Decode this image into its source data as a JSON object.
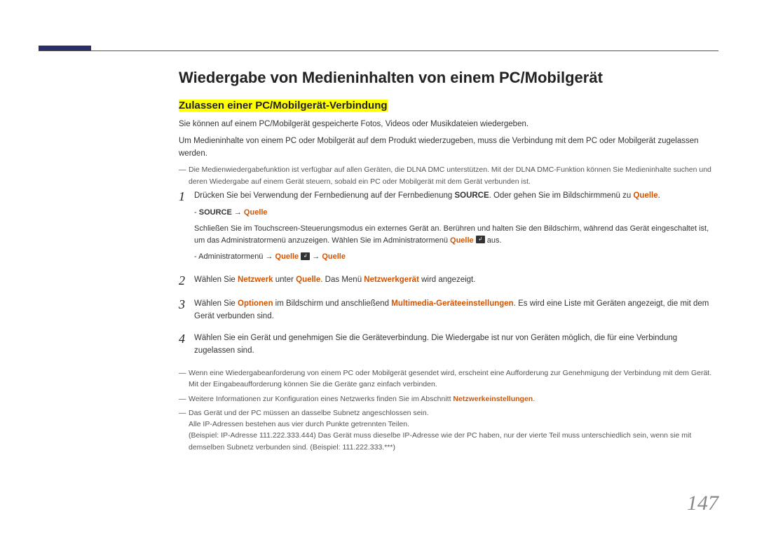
{
  "heading": "Wiedergabe von Medieninhalten von einem PC/Mobilgerät",
  "subheading": "Zulassen einer PC/Mobilgerät-Verbindung",
  "intro1": "Sie können auf einem PC/Mobilgerät gespeicherte Fotos, Videos oder Musikdateien wiedergeben.",
  "intro2": "Um Medieninhalte von einem PC oder Mobilgerät auf dem Produkt wiederzugeben, muss die Verbindung mit dem PC oder Mobilgerät zugelassen werden.",
  "note_top": "Die Medienwiedergabefunktion ist verfügbar auf allen Geräten, die DLNA DMC unterstützen. Mit der DLNA DMC-Funktion können Sie Medieninhalte suchen und deren Wiedergabe auf einem Gerät steuern, sobald ein PC oder Mobilgerät mit dem Gerät verbunden ist.",
  "steps": [
    {
      "num": "1",
      "pre": "Drücken Sie bei Verwendung der Fernbedienung auf der Fernbedienung ",
      "bold1": "SOURCE",
      "mid1": ". Oder gehen Sie im Bildschirmmenü zu ",
      "orange1": "Quelle",
      "post1": ".",
      "sub1_pre": "- ",
      "sub1_b": "SOURCE",
      "sub1_arrow": " → ",
      "sub1_o": "Quelle",
      "line2_pre": "Schließen Sie im Touchscreen-Steuerungsmodus ein externes Gerät an. Berühren und halten Sie den Bildschirm, während das Gerät eingeschaltet ist, um das Administratormenü anzuzeigen. Wählen Sie im Administratormenü ",
      "line2_o": "Quelle",
      "line2_post": " aus.",
      "sub2_pre": "- Administratormenü → ",
      "sub2_o1": "Quelle",
      "sub2_arrow": " → ",
      "sub2_o2": "Quelle"
    },
    {
      "num": "2",
      "pre": "Wählen Sie ",
      "o1": "Netzwerk",
      "mid": " unter ",
      "o2": "Quelle",
      "mid2": ". Das Menü ",
      "o3": "Netzwerkgerät",
      "post": " wird angezeigt."
    },
    {
      "num": "3",
      "pre": "Wählen Sie ",
      "o1": "Optionen",
      "mid": " im Bildschirm und anschließend ",
      "o2": "Multimedia-Geräteeinstellungen",
      "post": ". Es wird eine Liste mit Geräten angezeigt, die mit dem Gerät verbunden sind."
    },
    {
      "num": "4",
      "text": "Wählen Sie ein Gerät und genehmigen Sie die Geräteverbindung. Die Wiedergabe ist nur von Geräten möglich, die für eine Verbindung zugelassen sind."
    }
  ],
  "footnotes": {
    "n1a": "Wenn eine Wiedergabeanforderung von einem PC oder Mobilgerät gesendet wird, erscheint eine Aufforderung zur Genehmigung der Verbindung mit dem Gerät.",
    "n1b": "Mit der Eingabeaufforderung können Sie die Geräte ganz einfach verbinden.",
    "n2_pre": "Weitere Informationen zur Konfiguration eines Netzwerks finden Sie im Abschnitt ",
    "n2_o": "Netzwerkeinstellungen",
    "n2_post": ".",
    "n3a": "Das Gerät und der PC müssen an dasselbe Subnetz angeschlossen sein.",
    "n3b": "Alle IP-Adressen bestehen aus vier durch Punkte getrennten Teilen.",
    "n3c": "(Beispiel: IP-Adresse 111.222.333.444) Das Gerät muss dieselbe IP-Adresse wie der PC haben, nur der vierte Teil muss unterschiedlich sein, wenn sie mit demselben Subnetz verbunden sind. (Beispiel: 111.222.333.***)"
  },
  "page": "147",
  "icon_glyph": "↲"
}
